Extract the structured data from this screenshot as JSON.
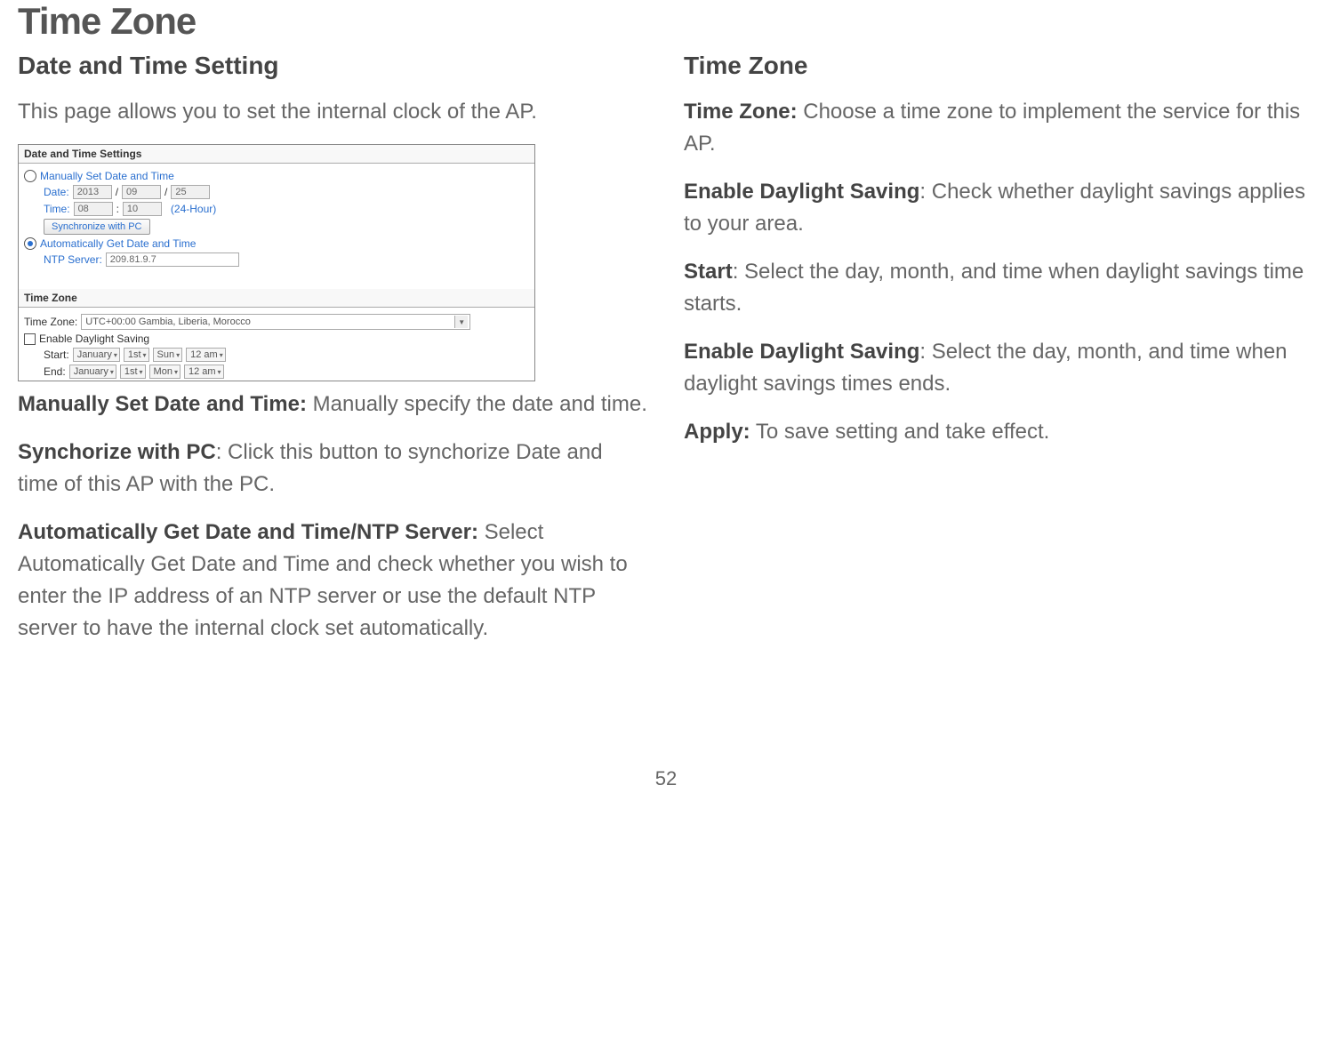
{
  "title": "Time Zone",
  "pageNumber": "52",
  "left": {
    "sectionTitle": "Date and Time Setting",
    "intro": "This page allows you to set the internal clock of the AP.",
    "screenshot": {
      "panel1Title": "Date and Time Settings",
      "manualLabel": "Manually Set Date and Time",
      "dateLabel": "Date:",
      "dateYear": "2013",
      "dateMonth": "09",
      "dateDay": "25",
      "slash": "/",
      "timeLabel": "Time:",
      "timeHour": "08",
      "timeMin": "10",
      "colon": ":",
      "timeSuffix": "(24-Hour)",
      "syncBtn": "Synchronize with PC",
      "autoLabel": "Automatically Get Date and Time",
      "ntpLabel": "NTP Server:",
      "ntpValue": "209.81.9.7",
      "panel2Title": "Time Zone",
      "tzLabel": "Time Zone:",
      "tzValue": "UTC+00:00 Gambia, Liberia, Morocco",
      "dstLabel": "Enable Daylight Saving",
      "startLabel": "Start:",
      "endLabel": "End:",
      "monthJan": "January",
      "first": "1st",
      "daySun": "Sun",
      "dayMon": "Mon",
      "time12am": "12 am"
    },
    "para1Bold": "Manually Set Date and Time:",
    "para1": " Manually specify the date and time.",
    "para2Bold": "Synchorize with PC",
    "para2": ": Click this button to synchorize Date and time of this AP with the PC.",
    "para3Bold": "Automatically Get Date and Time/NTP Server:",
    "para3": " Select Automatically Get Date and Time and check whether you wish to enter the IP address of an NTP server or use the default NTP server to have the internal clock set automatically."
  },
  "right": {
    "sectionTitle": "Time Zone",
    "p1Bold": "Time Zone:",
    "p1": " Choose a time zone to implement the service for this AP.",
    "p2Bold": "Enable Daylight Saving",
    "p2": ": Check whether daylight savings applies to your area.",
    "p3Bold": "Start",
    "p3": ": Select the day, month, and time when daylight savings time starts.",
    "p4Bold": "Enable Daylight Saving",
    "p4": ": Select the day, month, and time when daylight savings times ends.",
    "p5Bold": "Apply:",
    "p5": " To save setting and take effect."
  }
}
